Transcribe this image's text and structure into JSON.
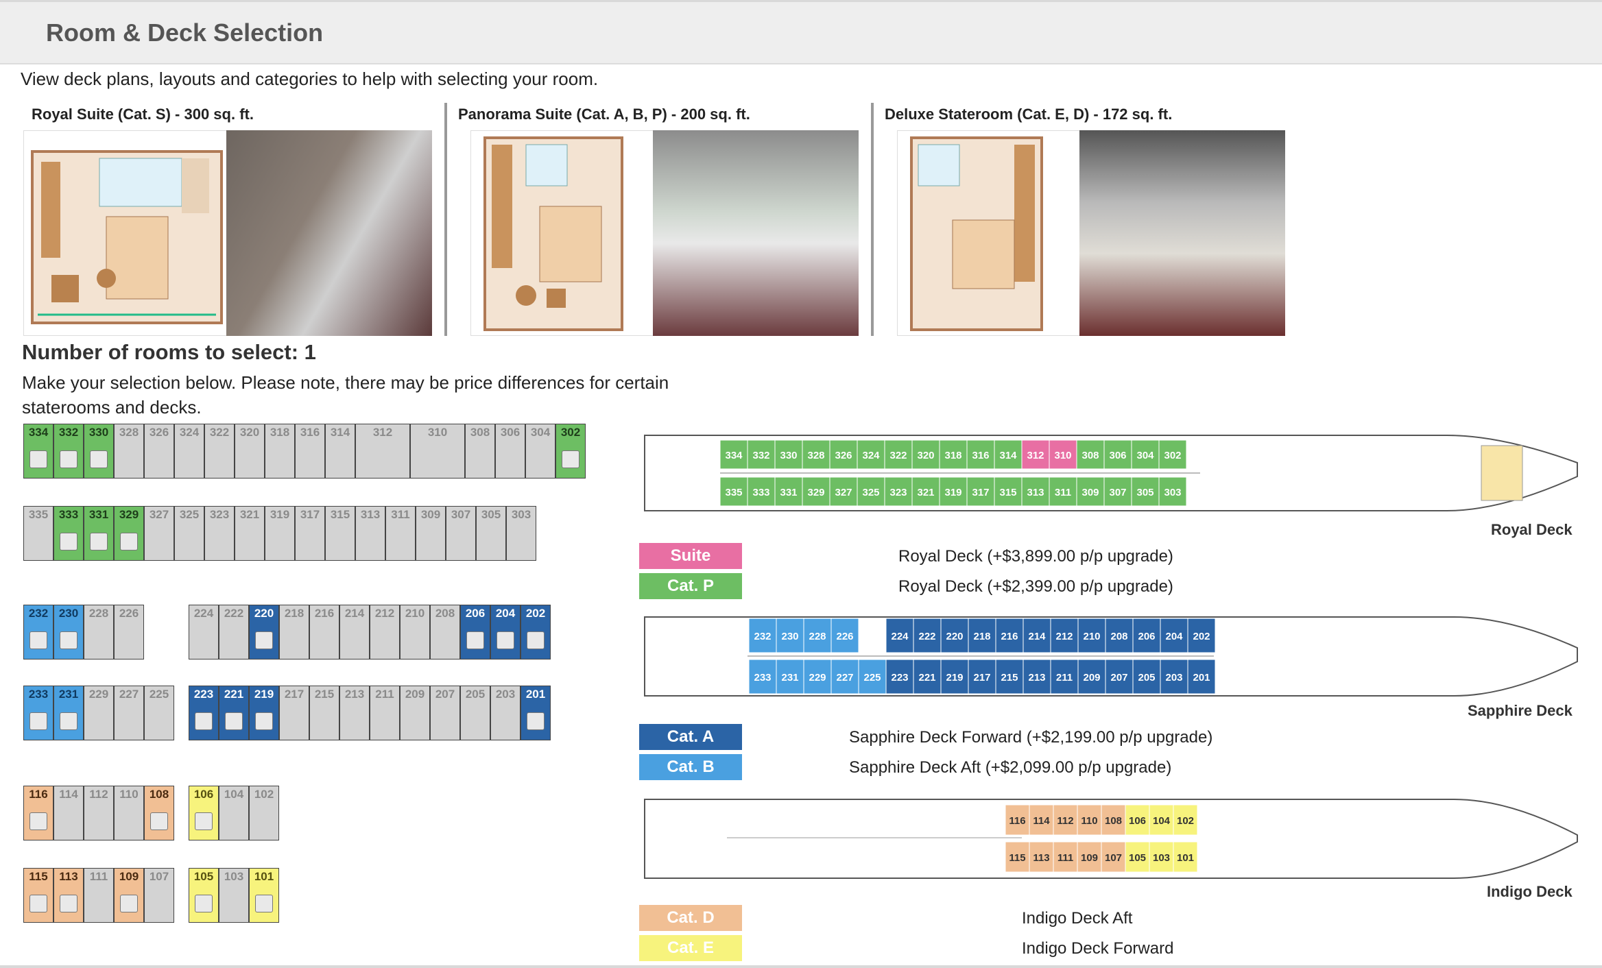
{
  "header": {
    "title": "Room & Deck Selection"
  },
  "intro": "View deck plans, layouts and categories to help with selecting your room.",
  "rooms": [
    {
      "title": "Royal Suite (Cat. S) - 300 sq. ft."
    },
    {
      "title": "Panorama Suite (Cat. A, B, P) - 200 sq. ft."
    },
    {
      "title": "Deluxe Stateroom (Cat. E, D) - 172 sq. ft."
    }
  ],
  "selection": {
    "heading": "Number of rooms to select: 1",
    "note": "Make your selection below. Please note, there may be price differences for certain staterooms and decks."
  },
  "grid": {
    "r300_top": [
      "334",
      "332",
      "330",
      "328",
      "326",
      "324",
      "322",
      "320",
      "318",
      "316",
      "314",
      "312",
      "310",
      "308",
      "306",
      "304",
      "302"
    ],
    "r300_bot": [
      "335",
      "333",
      "331",
      "329",
      "327",
      "325",
      "323",
      "321",
      "319",
      "317",
      "315",
      "313",
      "311",
      "309",
      "307",
      "305",
      "303"
    ],
    "r200_top_a": [
      "232",
      "230",
      "228",
      "226"
    ],
    "r200_top_b": [
      "224",
      "222",
      "220",
      "218",
      "216",
      "214",
      "212",
      "210",
      "208",
      "206",
      "204",
      "202"
    ],
    "r200_bot_a": [
      "233",
      "231",
      "229",
      "227",
      "225"
    ],
    "r200_bot_b": [
      "223",
      "221",
      "219",
      "217",
      "215",
      "213",
      "211",
      "209",
      "207",
      "205",
      "203",
      "201"
    ],
    "r100_top_a": [
      "116",
      "114",
      "112",
      "110",
      "108"
    ],
    "r100_top_b": [
      "106",
      "104",
      "102"
    ],
    "r100_bot_a": [
      "115",
      "113",
      "111",
      "109",
      "107"
    ],
    "r100_bot_b": [
      "105",
      "103",
      "101"
    ]
  },
  "decks": {
    "royal": {
      "name": "Royal Deck",
      "top": [
        "334",
        "332",
        "330",
        "328",
        "326",
        "324",
        "322",
        "320",
        "318",
        "316",
        "314",
        "312",
        "310",
        "308",
        "306",
        "304",
        "302"
      ],
      "bot": [
        "335",
        "333",
        "331",
        "329",
        "327",
        "325",
        "323",
        "321",
        "319",
        "317",
        "315",
        "313",
        "311",
        "309",
        "307",
        "305",
        "303"
      ]
    },
    "sapphire": {
      "name": "Sapphire Deck",
      "top": [
        "232",
        "230",
        "228",
        "226",
        "",
        "224",
        "222",
        "220",
        "218",
        "216",
        "214",
        "212",
        "210",
        "208",
        "206",
        "204",
        "202"
      ],
      "bot": [
        "233",
        "231",
        "229",
        "227",
        "225",
        "223",
        "221",
        "219",
        "217",
        "215",
        "213",
        "211",
        "209",
        "207",
        "205",
        "203",
        "201"
      ]
    },
    "indigo": {
      "name": "Indigo Deck",
      "top": [
        "116",
        "114",
        "112",
        "110",
        "108",
        "106",
        "104",
        "102"
      ],
      "bot": [
        "115",
        "113",
        "111",
        "109",
        "107",
        "105",
        "103",
        "101"
      ]
    }
  },
  "legend": [
    {
      "badge": "Suite",
      "text": "Royal Deck (+$3,899.00 p/p upgrade)",
      "color": "#e86fa3"
    },
    {
      "badge": "Cat. P",
      "text": "Royal Deck (+$2,399.00 p/p upgrade)",
      "color": "#6dbe63"
    },
    {
      "badge": "Cat. A",
      "text": "Sapphire Deck Forward (+$2,199.00 p/p upgrade)",
      "color": "#2b64a6"
    },
    {
      "badge": "Cat. B",
      "text": "Sapphire Deck Aft (+$2,099.00 p/p upgrade)",
      "color": "#4aa0e0"
    },
    {
      "badge": "Cat. D",
      "text": "Indigo Deck Aft",
      "color": "#f1bf94"
    },
    {
      "badge": "Cat. E",
      "text": "Indigo Deck Forward",
      "color": "#f7f37d"
    }
  ],
  "colors": {
    "catP": "#6dbe63",
    "catA": "#2b64a6",
    "catB": "#4aa0e0",
    "catD": "#f1bf94",
    "catE": "#f7f37d",
    "suite": "#e86fa3",
    "unavailable": "#d3d3d3"
  }
}
